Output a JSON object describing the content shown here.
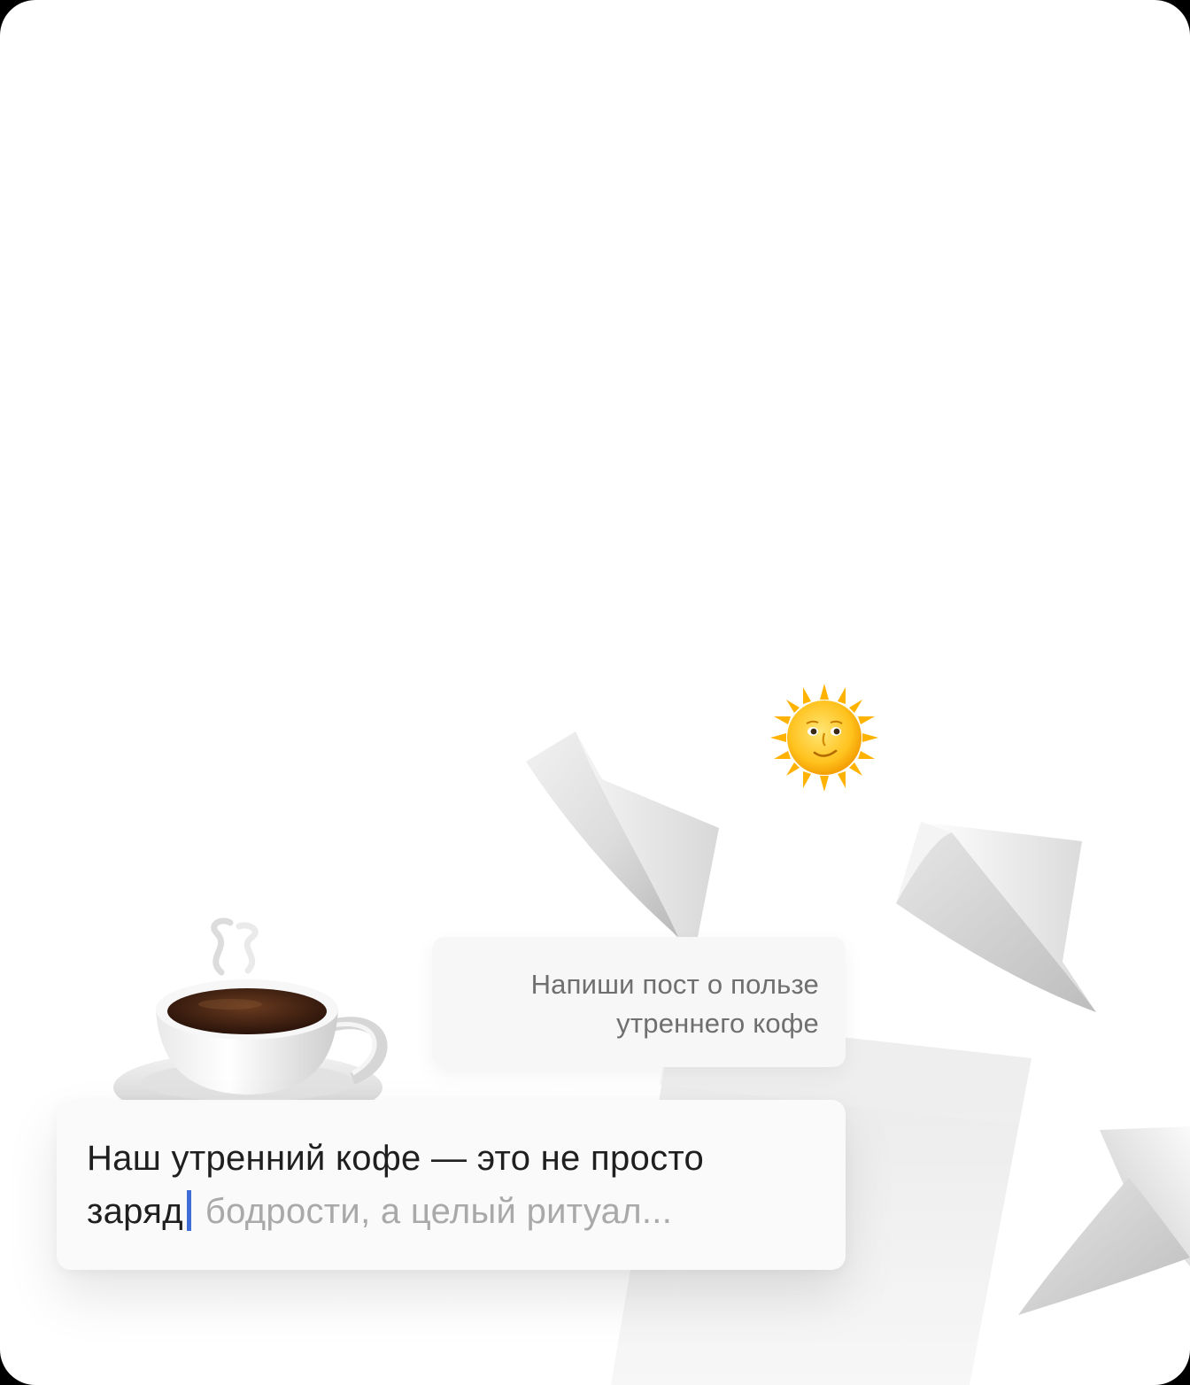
{
  "prompt": {
    "line1": "Напиши пост о пользе",
    "line2": "утреннего кофе"
  },
  "answer": {
    "typed_line1": "Наш утренний кофе — это не просто",
    "typed_line2": "заряд",
    "suggestion": "бодрости, а целый ритуал..."
  },
  "icons": {
    "sun": "sun-with-face-icon",
    "coffee": "hot-beverage-icon",
    "papers": "paper-sheet-icon"
  },
  "colors": {
    "background": "#ffffff",
    "frame": "#000000",
    "prompt_text": "#6f6f6f",
    "typed_text": "#1f1f1f",
    "suggestion_text": "#a9a9a9",
    "caret": "#3f6fd6"
  }
}
